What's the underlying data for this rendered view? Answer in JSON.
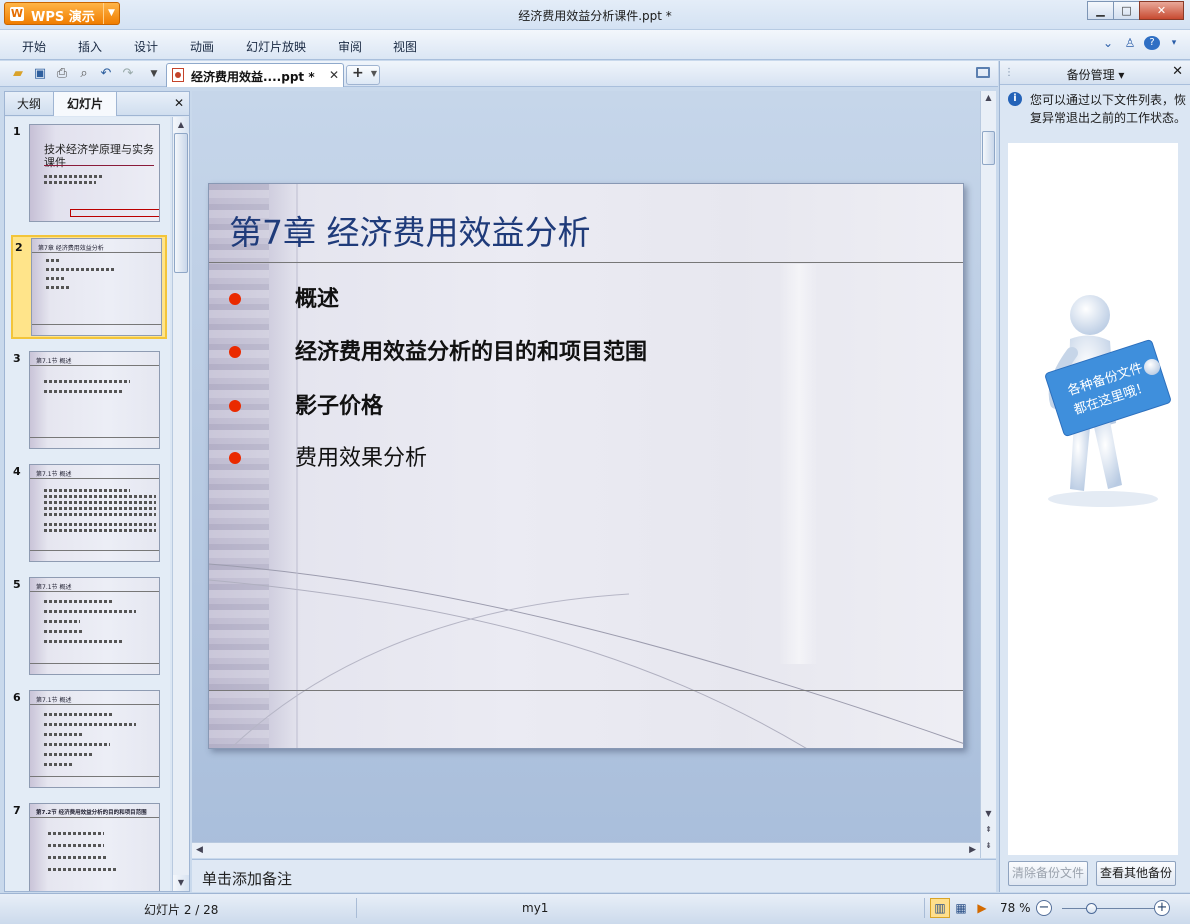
{
  "app": {
    "name": "WPS 演示",
    "logo": "W"
  },
  "window": {
    "title": "经济费用效益分析课件.ppt *"
  },
  "menu": [
    "开始",
    "插入",
    "设计",
    "动画",
    "幻灯片放映",
    "审阅",
    "视图"
  ],
  "document_tab": {
    "label": "经济费用效益....ppt *"
  },
  "left_panel": {
    "tabs": [
      "大纲",
      "幻灯片"
    ],
    "active_tab": "幻灯片",
    "slides": [
      {
        "num": "1",
        "title": "技术经济学原理与实务课件"
      },
      {
        "num": "2",
        "title": "第7章 经济费用效益分析"
      },
      {
        "num": "3",
        "title": "第7.1节 概述"
      },
      {
        "num": "4",
        "title": "第7.1节 概述"
      },
      {
        "num": "5",
        "title": "第7.1节 概述"
      },
      {
        "num": "6",
        "title": "第7.1节 概述"
      },
      {
        "num": "7",
        "title": "第7.2节 经济费用效益分析的目的和项目范围"
      }
    ],
    "selected_slide": "2"
  },
  "slide": {
    "title": "第7章 经济费用效益分析",
    "bullets": [
      {
        "text": "概述",
        "bold": true
      },
      {
        "text": "经济费用效益分析的目的和项目范围",
        "bold": true
      },
      {
        "text": "影子价格",
        "bold": true
      },
      {
        "text": "费用效果分析",
        "bold": false
      }
    ],
    "bullet_color": "#ea2a00"
  },
  "notes": {
    "placeholder": "单击添加备注"
  },
  "backup_panel": {
    "title": "备份管理",
    "info": "您可以通过以下文件列表，恢复异常退出之前的工作状态。",
    "sign_text": [
      "各种备份文件",
      "都在这里哦！"
    ],
    "clear_button": "清除备份文件",
    "view_button": "查看其他备份"
  },
  "status": {
    "slide_counter": "幻灯片 2 / 28",
    "template": "my1",
    "zoom": "78 %"
  },
  "icons": {
    "open": "folder-open-icon",
    "save": "save-icon",
    "print": "print-icon",
    "preview": "print-preview-icon",
    "undo": "undo-icon",
    "redo": "redo-icon"
  }
}
